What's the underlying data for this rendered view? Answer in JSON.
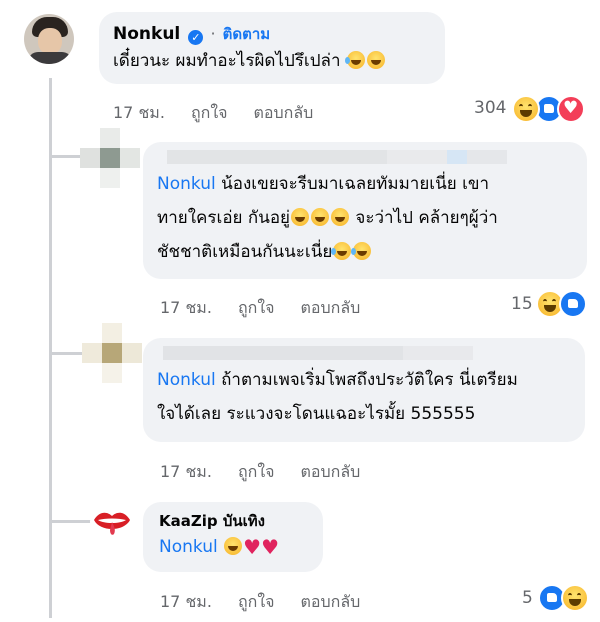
{
  "comments": [
    {
      "author": "Nonkul",
      "verified": true,
      "follow_label": "ติดตาม",
      "separator": "·",
      "text": "เดี๋ยวนะ ผมทำอะไรผิดไปรึเปล่า",
      "time": "17 ชม.",
      "like_label": "ถูกใจ",
      "reply_label": "ตอบกลับ",
      "reaction_count": "304",
      "reactions": [
        "haha-icon",
        "like-icon",
        "love-icon"
      ]
    }
  ],
  "replies": [
    {
      "author_hidden": true,
      "mention": "Nonkul",
      "text_lines": [
        "น้องเขยจะรีบมาเฉลยทัมมายเนี่ย เขา",
        "ทายใครเอ่ย กันอยู่",
        " จะว่าไป คล้ายๆผู้ว่า",
        "ชัชชาติเหมือนกันนะเนี่ย"
      ],
      "time": "17 ชม.",
      "like_label": "ถูกใจ",
      "reply_label": "ตอบกลับ",
      "reaction_count": "15"
    },
    {
      "author_hidden": true,
      "mention": "Nonkul",
      "text_lines": [
        " ถ้าตามเพจเริ่มโพสถึงประวัติใคร นี่เตรียม",
        "ใจได้เลย ระแวงจะโดนแฉอะไรมั้ย 555555"
      ],
      "time": "17 ชม.",
      "like_label": "ถูกใจ",
      "reply_label": "ตอบกลับ",
      "reaction_count": ""
    },
    {
      "author": "KaaZip บันเทิง",
      "mention": "Nonkul",
      "time": "17 ชม.",
      "like_label": "ถูกใจ",
      "reply_label": "ตอบกลับ",
      "reaction_count": "5"
    }
  ],
  "colors": {
    "bubble": "#f0f2f5",
    "link": "#1877f2",
    "meta": "#65676b",
    "like": "#1877f2",
    "love": "#f33e58",
    "haha": "#f7b125"
  }
}
